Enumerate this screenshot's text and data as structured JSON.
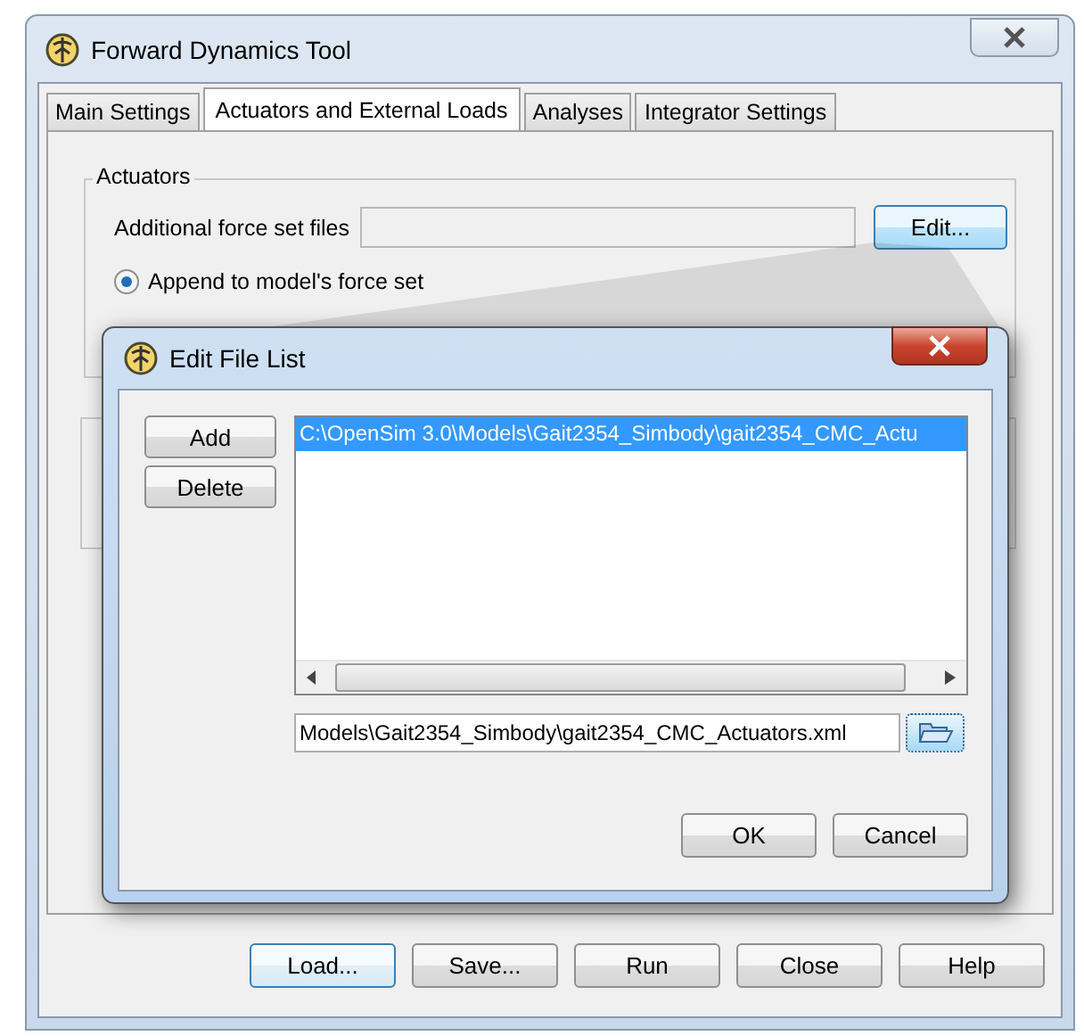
{
  "window": {
    "title": "Forward Dynamics Tool"
  },
  "tabs": [
    {
      "label": "Main Settings",
      "selected": false
    },
    {
      "label": "Actuators and External Loads",
      "selected": true
    },
    {
      "label": "Analyses",
      "selected": false
    },
    {
      "label": "Integrator Settings",
      "selected": false
    }
  ],
  "actuators": {
    "title": "Actuators",
    "field_label": "Additional force set files",
    "edit_button": "Edit...",
    "radios": [
      {
        "label": "Append to model's force set",
        "selected": true
      }
    ]
  },
  "dialog": {
    "title": "Edit File List",
    "side_buttons": [
      "Add",
      "Delete"
    ],
    "files": [
      {
        "path": "C:\\OpenSim 3.0\\Models\\Gait2354_Simbody\\gait2354_CMC_Actu",
        "selected": true
      }
    ],
    "path_value": "Models\\Gait2354_Simbody\\gait2354_CMC_Actuators.xml",
    "actions": [
      "OK",
      "Cancel"
    ]
  },
  "buttons": [
    {
      "label": "Load...",
      "focused": true
    },
    {
      "label": "Save...",
      "focused": false
    },
    {
      "label": "Run",
      "focused": false
    },
    {
      "label": "Close",
      "focused": false
    },
    {
      "label": "Help",
      "focused": false
    }
  ]
}
